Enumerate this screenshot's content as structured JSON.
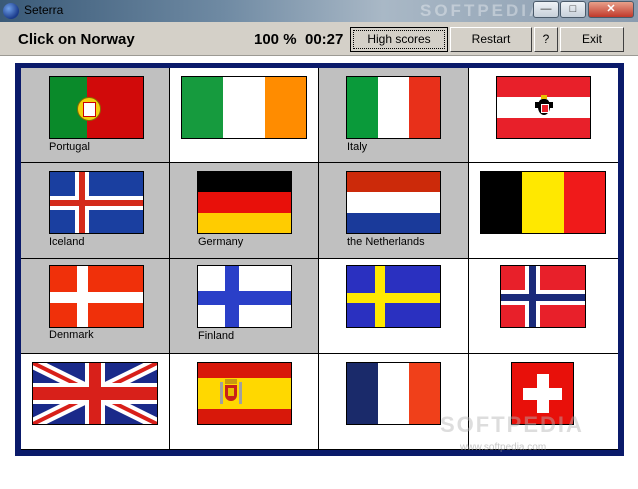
{
  "window": {
    "title": "Seterra",
    "watermark_top": "SOFTPEDIA",
    "icon": "globe-icon"
  },
  "toolbar": {
    "prompt": "Click on Norway",
    "score": "100 %",
    "timer": "00:27",
    "high_scores_label": "High scores",
    "restart_label": "Restart",
    "help_label": "?",
    "exit_label": "Exit"
  },
  "flags": [
    {
      "country": "portugal",
      "label": "Portugal",
      "guessed": true
    },
    {
      "country": "ireland",
      "label": "",
      "guessed": false
    },
    {
      "country": "italy",
      "label": "Italy",
      "guessed": true
    },
    {
      "country": "austria",
      "label": "",
      "guessed": false
    },
    {
      "country": "iceland",
      "label": "Iceland",
      "guessed": true
    },
    {
      "country": "germany",
      "label": "Germany",
      "guessed": true
    },
    {
      "country": "netherlands",
      "label": "the Netherlands",
      "guessed": true
    },
    {
      "country": "belgium",
      "label": "",
      "guessed": false
    },
    {
      "country": "denmark",
      "label": "Denmark",
      "guessed": true
    },
    {
      "country": "finland",
      "label": "Finland",
      "guessed": true
    },
    {
      "country": "sweden",
      "label": "",
      "guessed": false
    },
    {
      "country": "norway",
      "label": "",
      "guessed": false
    },
    {
      "country": "united-kingdom",
      "label": "",
      "guessed": false
    },
    {
      "country": "spain",
      "label": "",
      "guessed": false
    },
    {
      "country": "france",
      "label": "",
      "guessed": false
    },
    {
      "country": "switzerland",
      "label": "",
      "guessed": false
    }
  ],
  "watermark": {
    "text": "SOFTPEDIA",
    "url": "www.softpedia.com"
  }
}
